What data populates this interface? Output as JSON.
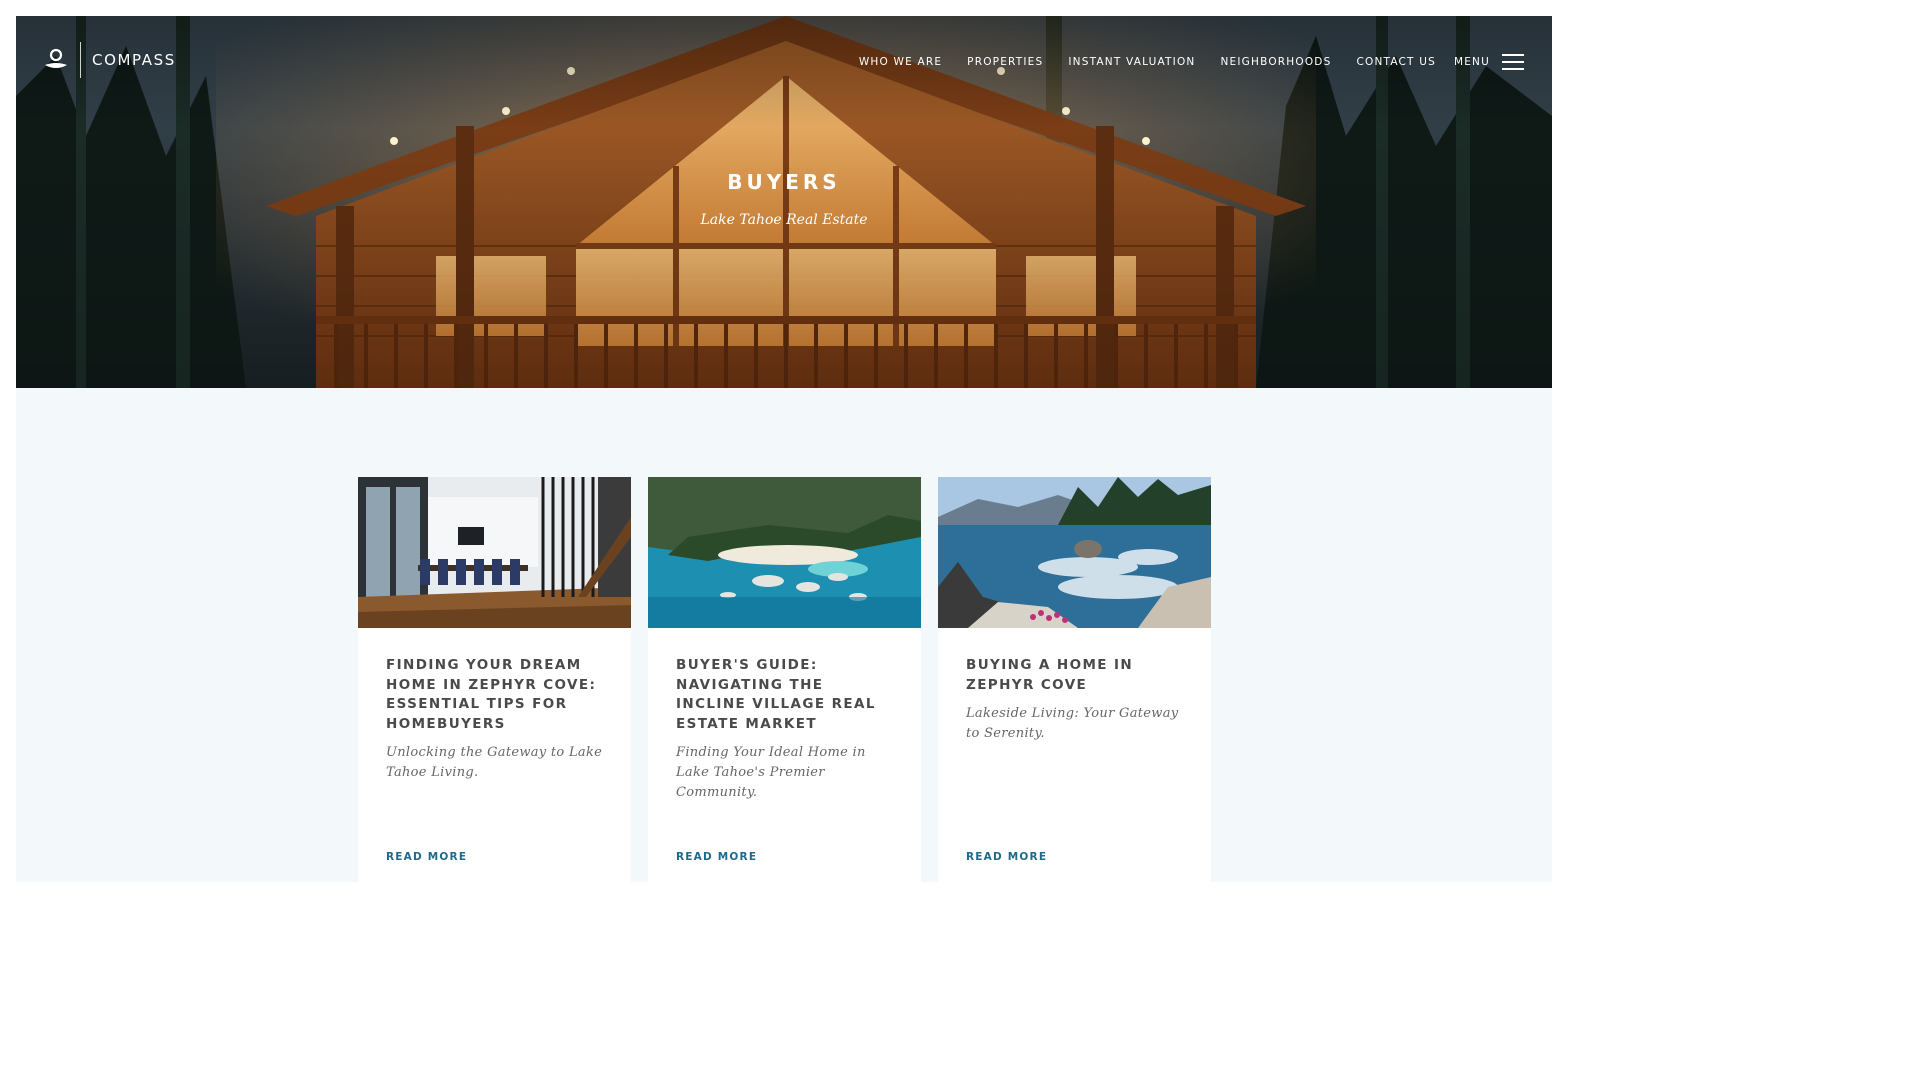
{
  "header": {
    "logo_text": "COMPASS",
    "nav": [
      {
        "label": "WHO WE ARE"
      },
      {
        "label": "PROPERTIES"
      },
      {
        "label": "INSTANT VALUATION"
      },
      {
        "label": "NEIGHBORHOODS"
      },
      {
        "label": "CONTACT US"
      }
    ],
    "menu_label": "MENU",
    "menu_icon": "hamburger-icon"
  },
  "hero": {
    "title": "BUYERS",
    "subtitle": "Lake Tahoe Real Estate",
    "image": "log-cabin-at-night"
  },
  "cards": [
    {
      "image": "modern-dining-room",
      "title": "Finding Your Dream Home in Zephyr Cove: Essential Tips for Homebuyers",
      "subtitle": "Unlocking the Gateway to Lake Tahoe Living.",
      "link": "READ MORE"
    },
    {
      "image": "aerial-lake-cove",
      "title": "Buyer's Guide: Navigating the Incline Village Real Estate Market",
      "subtitle": "Finding Your Ideal Home in Lake Tahoe's Premier Community.",
      "link": "READ MORE"
    },
    {
      "image": "lakeshore-rocks",
      "title": "Buying a Home in Zephyr Cove",
      "subtitle": "Lakeside Living: Your Gateway to Serenity.",
      "link": "READ MORE"
    }
  ],
  "colors": {
    "link": "#1f6a8a",
    "page_bg": "#f3f9fb"
  }
}
